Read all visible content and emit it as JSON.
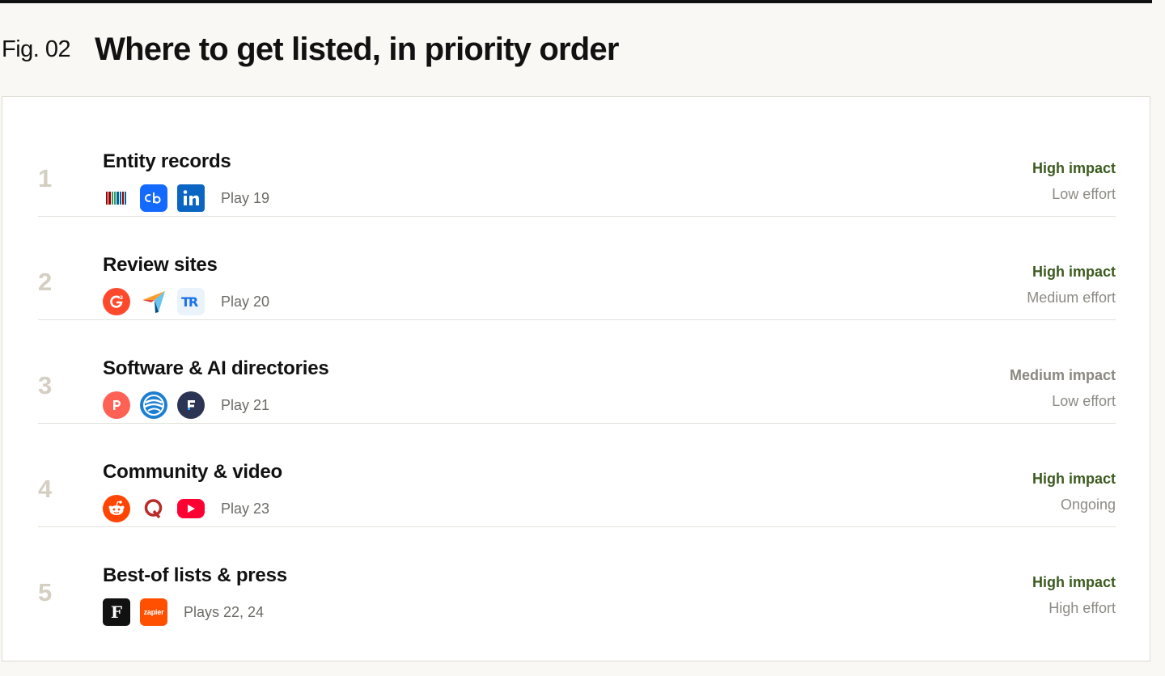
{
  "figure": {
    "label": "Fig. 02",
    "title": "Where to get listed, in priority order"
  },
  "colors": {
    "high_impact": "#3b5b1e",
    "medium_impact": "#8a887f",
    "rank": "#d4cfc1"
  },
  "rows": [
    {
      "rank": "1",
      "title": "Entity records",
      "icons": [
        "wikidata-icon",
        "crunchbase-icon",
        "linkedin-icon"
      ],
      "play": "Play 19",
      "impact": "High impact",
      "effort": "Low effort"
    },
    {
      "rank": "2",
      "title": "Review sites",
      "icons": [
        "g2-icon",
        "capterra-icon",
        "trustradius-icon"
      ],
      "play": "Play 20",
      "impact": "High impact",
      "effort": "Medium effort"
    },
    {
      "rank": "3",
      "title": "Software & AI directories",
      "icons": [
        "product-hunt-icon",
        "futurepedia-icon",
        "futuretools-icon"
      ],
      "play": "Play 21",
      "impact": "Medium impact",
      "effort": "Low effort"
    },
    {
      "rank": "4",
      "title": "Community & video",
      "icons": [
        "reddit-icon",
        "quora-icon",
        "youtube-icon"
      ],
      "play": "Play 23",
      "impact": "High impact",
      "effort": "Ongoing"
    },
    {
      "rank": "5",
      "title": "Best-of lists & press",
      "icons": [
        "forbes-icon",
        "zapier-icon"
      ],
      "icon_text": {
        "forbes": "F",
        "zapier": "zapier"
      },
      "play": "Plays 22, 24",
      "impact": "High impact",
      "effort": "High effort"
    }
  ]
}
